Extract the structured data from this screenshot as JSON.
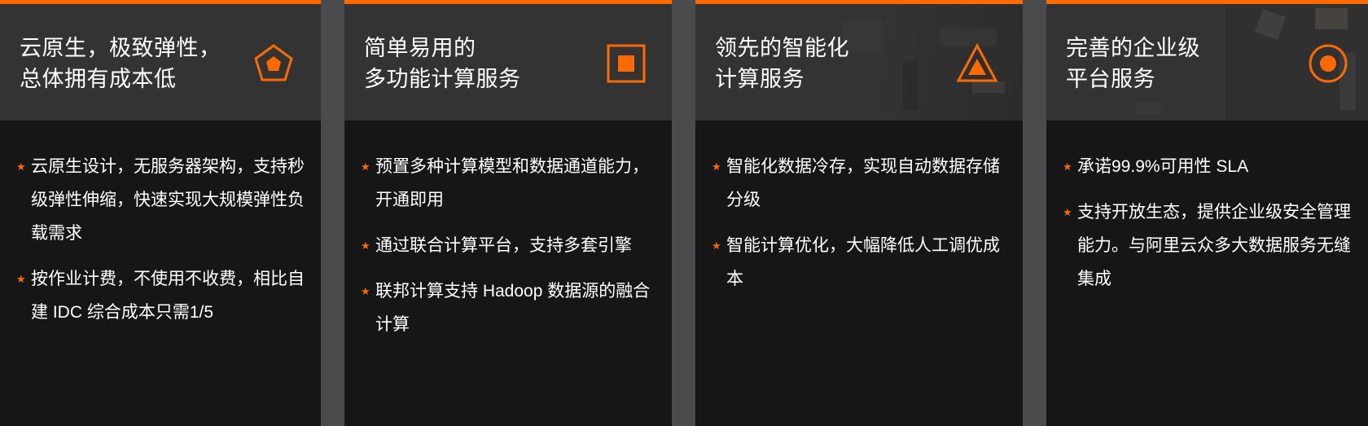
{
  "cards": [
    {
      "title_lines": [
        "云原生，极致弹性，",
        "总体拥有成本低"
      ],
      "icon": "pentagon-icon",
      "items": [
        "云原生设计，无服务器架构，支持秒级弹性伸缩，快速实现大规模弹性负载需求",
        "按作业计费，不使用不收费，相比自建 IDC 综合成本只需1/5"
      ]
    },
    {
      "title_lines": [
        "简单易用的",
        "多功能计算服务"
      ],
      "icon": "square-icon",
      "items": [
        "预置多种计算模型和数据通道能力，开通即用",
        "通过联合计算平台，支持多套引擎",
        "联邦计算支持 Hadoop 数据源的融合计算"
      ]
    },
    {
      "title_lines": [
        "领先的智能化",
        "计算服务"
      ],
      "icon": "triangle-icon",
      "items": [
        "智能化数据冷存，实现自动数据存储分级",
        "智能计算优化，大幅降低人工调优成本"
      ]
    },
    {
      "title_lines": [
        "完善的企业级",
        "平台服务"
      ],
      "icon": "circle-target-icon",
      "items": [
        "承诺99.9%可用性 SLA",
        "支持开放生态，提供企业级安全管理能力。与阿里云众多大数据服务无缝集成"
      ]
    }
  ],
  "colors": {
    "accent": "#ff6a00",
    "card_bg": "#161616",
    "head_bg": "#333334",
    "gap_bg": "#4b4b4d"
  }
}
